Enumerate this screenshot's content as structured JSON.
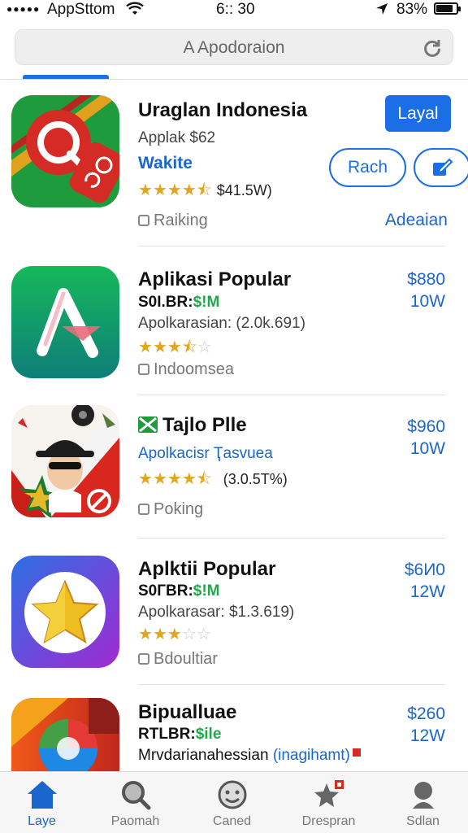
{
  "status_bar": {
    "carrier": "AppSttom",
    "time": "6:: 30",
    "battery_pct": "83%",
    "battery_level": 0.83
  },
  "search": {
    "placeholder": "A Apodoraion"
  },
  "items": [
    {
      "title": "Uraglan Indonesia",
      "subtitle": "Applak $62",
      "tag": "Wakite",
      "rating": 4.5,
      "rating_text": "$41.5W)",
      "meta": "Raiking",
      "button_primary": "Layal",
      "button_secondary": "Rach",
      "link": "Adeaian"
    },
    {
      "title": "Aplikasi Popular",
      "sub_prefix": "S0I.BR:",
      "sub_green": "$!M",
      "line2": "Apolkarasian: (2.0k.691)",
      "rating": 3.5,
      "meta": "Indoomsea",
      "price": "$880",
      "price_sub": "10W"
    },
    {
      "title": "Tajlo Plle",
      "line_blue": "Apolkacisr Ҭasvuea",
      "rating": 4.5,
      "rating_text": "(3.0.5T%)",
      "meta": "Poking",
      "price": "$960",
      "price_sub": "10W"
    },
    {
      "title": "Aplktii Popular",
      "sub_prefix": "S0ГBR:",
      "sub_green": "$!M",
      "line2": "Apolkarasar: $1.3.619)",
      "rating": 3,
      "meta": "Bdoultiar",
      "price": "$6И0",
      "price_sub": "12W"
    },
    {
      "title": "Bipualluae",
      "sub_prefix": "RTLBR:",
      "sub_green": "$ile",
      "line2_dark": "Mrvdarianahessian",
      "line2_blue": "(inagihamt)",
      "price": "$260",
      "price_sub": "12W"
    }
  ],
  "tabs": [
    {
      "label": "Laye",
      "icon": "home-icon",
      "active": true
    },
    {
      "label": "Paomah",
      "icon": "search-icon",
      "active": false
    },
    {
      "label": "Caned",
      "icon": "face-icon",
      "active": false
    },
    {
      "label": "Drespran",
      "icon": "star-badge-icon",
      "active": false
    },
    {
      "label": "Sdlan",
      "icon": "person-icon",
      "active": false
    }
  ],
  "colors": {
    "accent": "#1b6ee6",
    "star": "#e3a51b",
    "green": "#23a64a"
  }
}
